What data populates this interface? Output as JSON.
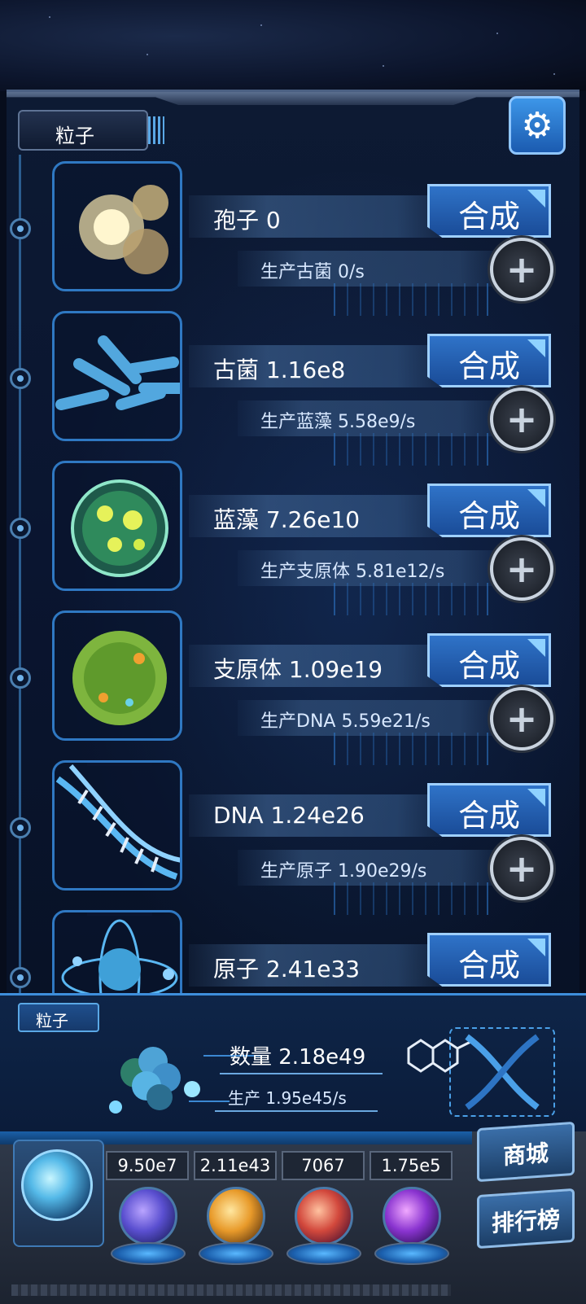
{
  "header": {
    "tab_title": "粒子",
    "settings_icon": "gear-icon"
  },
  "items": [
    {
      "name_label": "孢子 0",
      "synth_label": "合成",
      "prod_label": "生产古菌 0/s",
      "icon": "spore-icon"
    },
    {
      "name_label": "古菌 1.16e8",
      "synth_label": "合成",
      "prod_label": "生产蓝藻 5.58e9/s",
      "icon": "archaea-icon"
    },
    {
      "name_label": "蓝藻 7.26e10",
      "synth_label": "合成",
      "prod_label": "生产支原体 5.81e12/s",
      "icon": "cyanobacteria-icon"
    },
    {
      "name_label": "支原体 1.09e19",
      "synth_label": "合成",
      "prod_label": "生产DNA 5.59e21/s",
      "icon": "mycoplasma-icon"
    },
    {
      "name_label": "DNA 1.24e26",
      "synth_label": "合成",
      "prod_label": "生产原子 1.90e29/s",
      "icon": "dna-icon"
    },
    {
      "name_label": "原子 2.41e33",
      "synth_label": "合成",
      "prod_label": "",
      "icon": "atom-icon"
    }
  ],
  "summary": {
    "tag": "粒子",
    "count_label": "数量 2.18e49",
    "rate_label": "生产 1.95e45/s"
  },
  "resources": [
    {
      "value": "9.50e7",
      "icon": "lightning-orb-icon"
    },
    {
      "value": "2.11e43",
      "icon": "fire-orb-icon"
    },
    {
      "value": "7067",
      "icon": "brain-orb-icon"
    },
    {
      "value": "1.75e5",
      "icon": "vortex-orb-icon"
    }
  ],
  "side_buttons": {
    "shop": "商城",
    "ranking": "排行榜"
  },
  "colors": {
    "accent": "#2f73c8",
    "panel": "#0a1530",
    "frame": "#2f78c2"
  }
}
